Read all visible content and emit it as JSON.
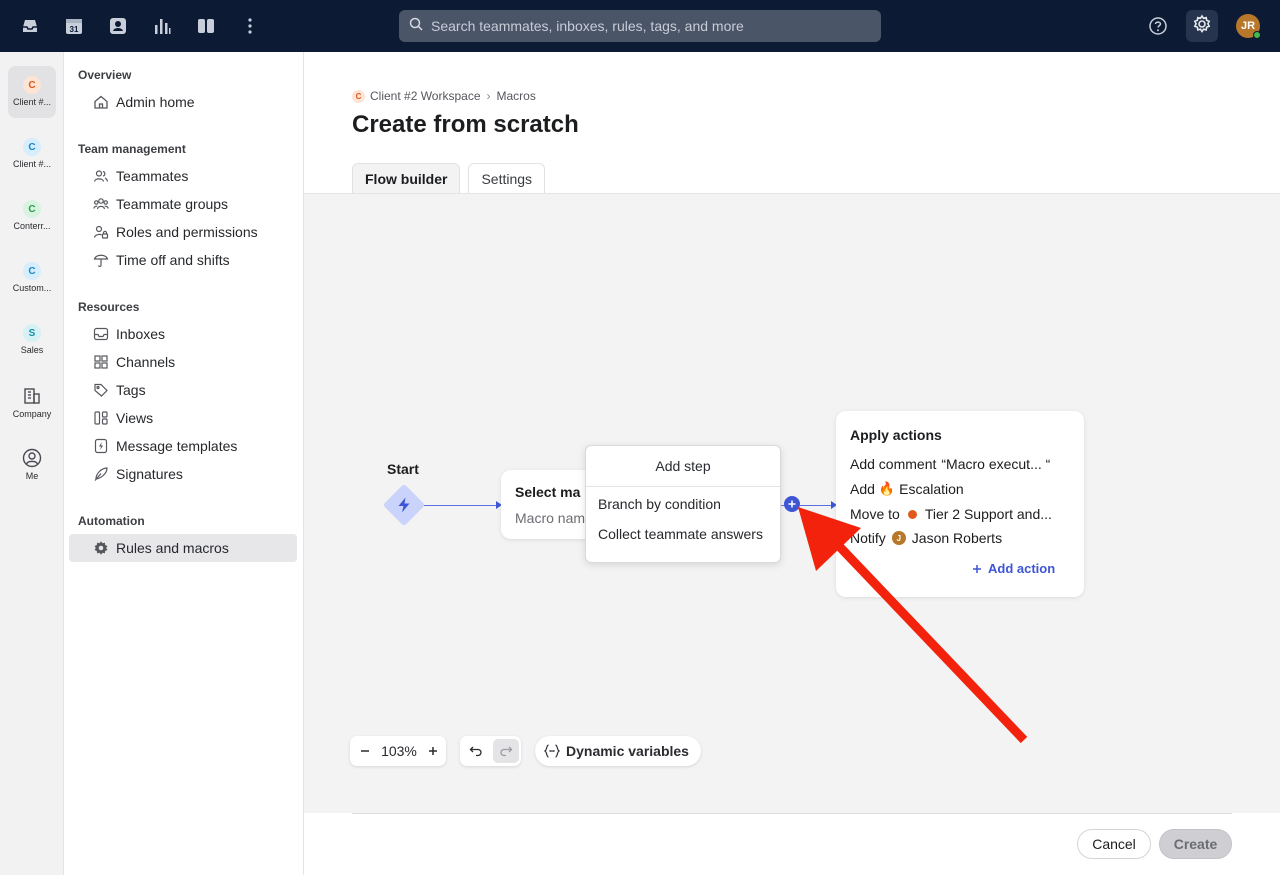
{
  "topbar": {
    "search_placeholder": "Search teammates, inboxes, rules, tags, and more",
    "calendar_day": "31",
    "user_initials": "JR",
    "icons": [
      "inbox-icon",
      "calendar-icon",
      "contacts-icon",
      "analytics-icon",
      "split-view-icon",
      "more-icon",
      "help-icon",
      "gear-icon"
    ]
  },
  "rail": {
    "workspaces": [
      {
        "badge": "C",
        "label": "Client #...",
        "active": true,
        "badge_bg": "#fde4d4",
        "badge_fg": "#d9591c"
      },
      {
        "badge": "C",
        "label": "Client #...",
        "active": false,
        "badge_bg": "#d6eefb",
        "badge_fg": "#1c86c3"
      },
      {
        "badge": "C",
        "label": "Conterr...",
        "active": false,
        "badge_bg": "#d8f3df",
        "badge_fg": "#2b9a4c"
      },
      {
        "badge": "C",
        "label": "Custom...",
        "active": false,
        "badge_bg": "#d6eefb",
        "badge_fg": "#1c86c3"
      },
      {
        "badge": "S",
        "label": "Sales",
        "active": false,
        "badge_bg": "#d6f1f5",
        "badge_fg": "#1a8fa3"
      }
    ],
    "company_label": "Company",
    "me_label": "Me"
  },
  "sidebar": {
    "sections": [
      {
        "title": "Overview",
        "items": [
          {
            "label": "Admin home",
            "icon": "home-icon"
          }
        ]
      },
      {
        "title": "Team management",
        "items": [
          {
            "label": "Teammates",
            "icon": "teammates-icon"
          },
          {
            "label": "Teammate groups",
            "icon": "teammate-groups-icon"
          },
          {
            "label": "Roles and permissions",
            "icon": "roles-icon"
          },
          {
            "label": "Time off and shifts",
            "icon": "umbrella-icon"
          }
        ]
      },
      {
        "title": "Resources",
        "items": [
          {
            "label": "Inboxes",
            "icon": "inbox-icon"
          },
          {
            "label": "Channels",
            "icon": "channels-icon"
          },
          {
            "label": "Tags",
            "icon": "tag-icon"
          },
          {
            "label": "Views",
            "icon": "views-icon"
          },
          {
            "label": "Message templates",
            "icon": "template-icon"
          },
          {
            "label": "Signatures",
            "icon": "signature-icon"
          }
        ]
      },
      {
        "title": "Automation",
        "items": [
          {
            "label": "Rules and macros",
            "icon": "gear-icon",
            "active": true
          }
        ]
      }
    ]
  },
  "main": {
    "breadcrumb": {
      "badge": "C",
      "workspace": "Client #2 Workspace",
      "page": "Macros"
    },
    "title": "Create from scratch",
    "tabs": [
      {
        "label": "Flow builder",
        "active": true
      },
      {
        "label": "Settings",
        "active": false
      }
    ],
    "flow": {
      "start_label": "Start",
      "select_card": {
        "title": "Select ma",
        "subtitle": "Macro nam"
      },
      "add_step": {
        "title": "Add step",
        "options": [
          "Branch by condition",
          "Collect teammate answers"
        ]
      },
      "actions_card": {
        "title": "Apply actions",
        "rows": [
          {
            "prefix": "Add comment",
            "value": "“Macro execut... “"
          },
          {
            "prefix": "Add",
            "emoji": "🔥",
            "value": "Escalation"
          },
          {
            "prefix": "Move to",
            "value": "Tier 2 Support and..."
          },
          {
            "prefix": "Notify",
            "avatar": "J",
            "value": "Jason Roberts"
          }
        ],
        "add_action": "Add action"
      }
    },
    "toolbar": {
      "zoom": "103%",
      "dynamic_variables": "Dynamic variables"
    },
    "buttons": {
      "cancel": "Cancel",
      "create": "Create"
    }
  },
  "colors": {
    "accent": "#3e55d6",
    "annotation_arrow": "#f2220c",
    "topbar": "#0c1a33"
  }
}
